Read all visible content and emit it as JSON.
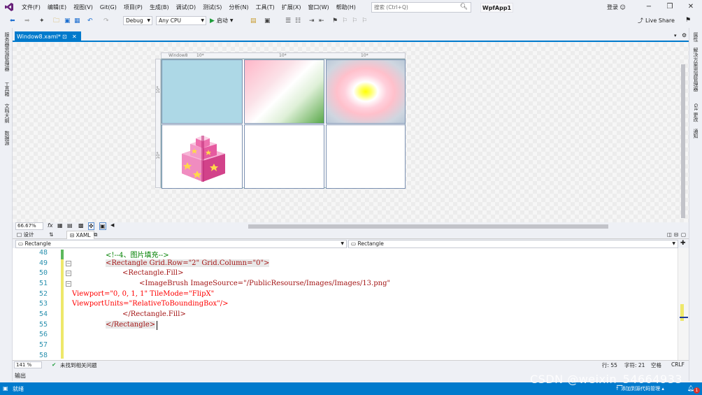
{
  "menu": {
    "items": [
      "文件(F)",
      "编辑(E)",
      "视图(V)",
      "Git(G)",
      "项目(P)",
      "生成(B)",
      "调试(D)",
      "测试(S)",
      "分析(N)",
      "工具(T)",
      "扩展(X)",
      "窗口(W)",
      "帮助(H)"
    ],
    "search_placeholder": "搜索 (Ctrl+Q)",
    "project_name": "WpfApp1",
    "login_label": "登录"
  },
  "toolbar": {
    "config": "Debug",
    "platform": "Any CPU",
    "start_label": "启动",
    "live_share": "Live Share"
  },
  "left_panels": [
    "服务器资源管理器",
    "工具箱",
    "文档大纲",
    "数据源"
  ],
  "right_panels": [
    "属性",
    "解决方案资源管理器",
    "Git 更改",
    "通知"
  ],
  "document_tab": {
    "title": "Window8.xaml*"
  },
  "designer": {
    "window_label": "Window8",
    "ruler_labels": [
      "10*",
      "10*",
      "10*"
    ],
    "row_labels": [
      "10*",
      "10*"
    ],
    "zoom": "66.67%",
    "fx_label": "fx"
  },
  "view_tabs": {
    "design": "设计",
    "xaml": "XAML"
  },
  "nav": {
    "left": "Rectangle",
    "right": "Rectangle"
  },
  "editor": {
    "lines": [
      {
        "num": "48",
        "text": "<!--4、图片填充-->"
      },
      {
        "num": "49",
        "text": "<Rectangle Grid.Row=\"2\" Grid.Column=\"0\">"
      },
      {
        "num": "50",
        "text": "<Rectangle.Fill>"
      },
      {
        "num": "51",
        "text": "<ImageBrush ImageSource=\"/PublicResourse/Images/Images/13.png\""
      },
      {
        "num": "52",
        "text": "Viewport=\"0, 0, 1, 1\" TileMode=\"FlipX\""
      },
      {
        "num": "53",
        "text": "ViewportUnits=\"RelativeToBoundingBox\"/>"
      },
      {
        "num": "54",
        "text": "</Rectangle.Fill>"
      },
      {
        "num": "55",
        "text": "</Rectangle>"
      },
      {
        "num": "56",
        "text": ""
      },
      {
        "num": "57",
        "text": ""
      },
      {
        "num": "58",
        "text": ""
      }
    ]
  },
  "editor_status": {
    "zoom": "141 %",
    "issues": "未找到相关问题",
    "line": "行: 55",
    "char": "字符: 21",
    "space": "空格",
    "eol": "CRLF"
  },
  "output_label": "输出",
  "status": {
    "ready": "就绪",
    "source_control": "添加到源代码管理",
    "notifications": "1"
  },
  "watermark": "CSDN @weixin_54664933",
  "colors": {
    "accent": "#007acc",
    "cell_blue": "#add8e6"
  }
}
